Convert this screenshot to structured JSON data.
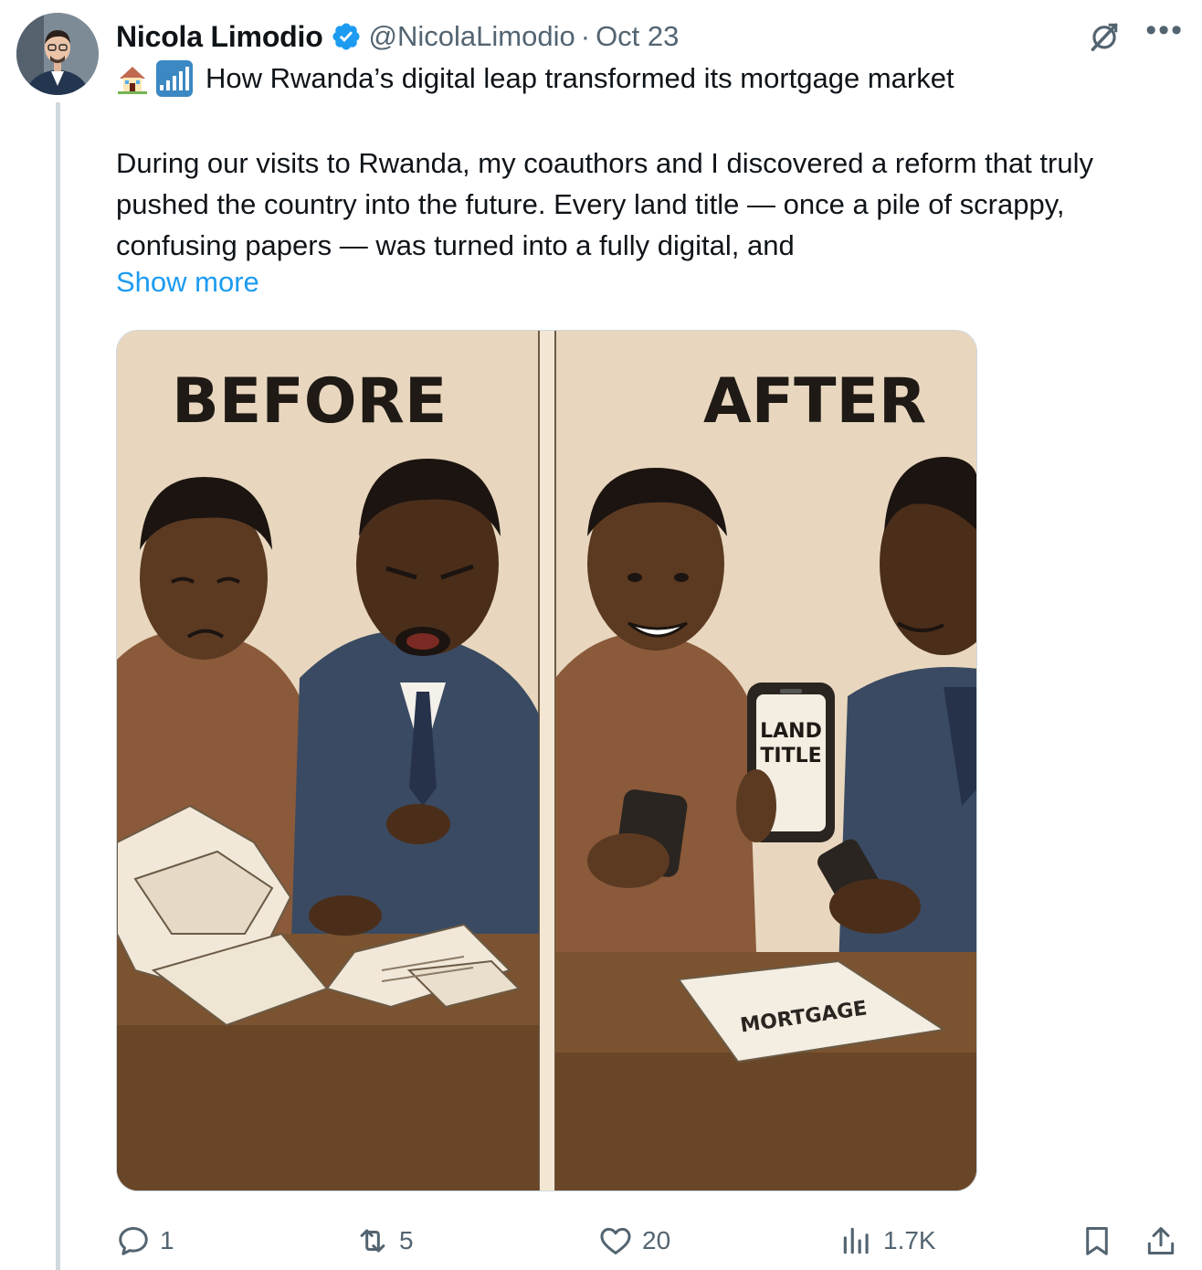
{
  "author": {
    "name": "Nicola Limodio",
    "handle": "@NicolaLimodio",
    "separator": "·",
    "date": "Oct 23"
  },
  "post": {
    "title": "How Rwanda’s digital leap transformed its mortgage market",
    "title_emojis": [
      "house-emoji",
      "signal-bars-emoji"
    ],
    "body_lines": [
      "During our visits to Rwanda, my coauthors and I discovered a reform that truly",
      "pushed the country into the future. Every land title — once a pile of scrappy,",
      "confusing papers — was turned into a fully digital, and"
    ],
    "show_more": "Show more"
  },
  "media": {
    "before_label": "BEFORE",
    "after_label": "AFTER",
    "phone_text_line1": "LAND",
    "phone_text_line2": "TITLE",
    "card_text": "MORTGAGE"
  },
  "actions": {
    "replies": "1",
    "reposts": "5",
    "likes": "20",
    "views": "1.7K"
  },
  "colors": {
    "accent": "#1d9bf0",
    "muted": "#536471",
    "thread_line": "#cfd9de",
    "verified": "#1d9bf0"
  },
  "icons": [
    "grok-icon",
    "more-icon",
    "reply-icon",
    "repost-icon",
    "like-icon",
    "views-icon",
    "bookmark-icon",
    "share-icon",
    "verified-badge-icon"
  ]
}
